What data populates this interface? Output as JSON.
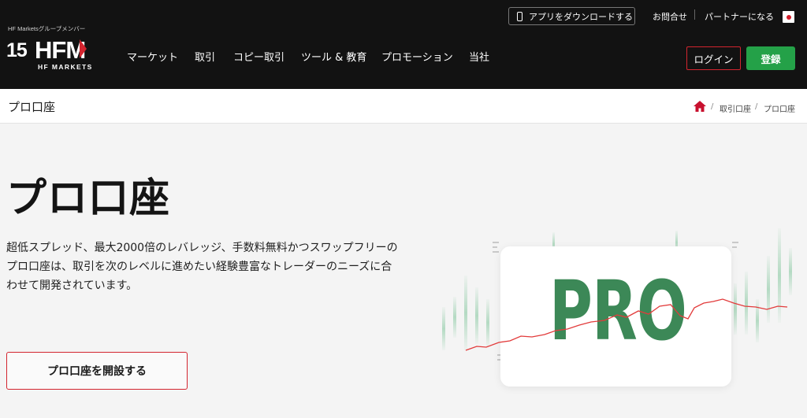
{
  "header": {
    "logo": {
      "group_text": "HF Marketsグループメンバー",
      "anniversary": "15",
      "brand": "HFM",
      "sub": "HF MARKETS"
    },
    "app_download_label": "アプリをダウンロードする",
    "contact_label": "お問合せ",
    "partner_label": "パートナーになる",
    "nav": [
      "マーケット",
      "取引",
      "コピー取引",
      "ツール & 教育",
      "プロモーション",
      "当社"
    ],
    "login_label": "ログイン",
    "register_label": "登録",
    "colors": {
      "background": "#121212",
      "accent_red": "#d3252f",
      "accent_green": "#24a148"
    }
  },
  "breadcrumb": {
    "page_title": "プロ口座",
    "items": [
      "取引口座",
      "プロ口座"
    ]
  },
  "hero": {
    "title": "プロ口座",
    "description": "超低スプレッド、最大2000倍のレバレッジ、手数料無料かつスワップフリーのプロ口座は、取引を次のレベルに進めたい経験豊富なトレーダーのニーズに合わせて開発されています。",
    "cta_label": "プロ口座を開設する",
    "badge_text": "PRO",
    "badge_color": "#3c8857"
  }
}
